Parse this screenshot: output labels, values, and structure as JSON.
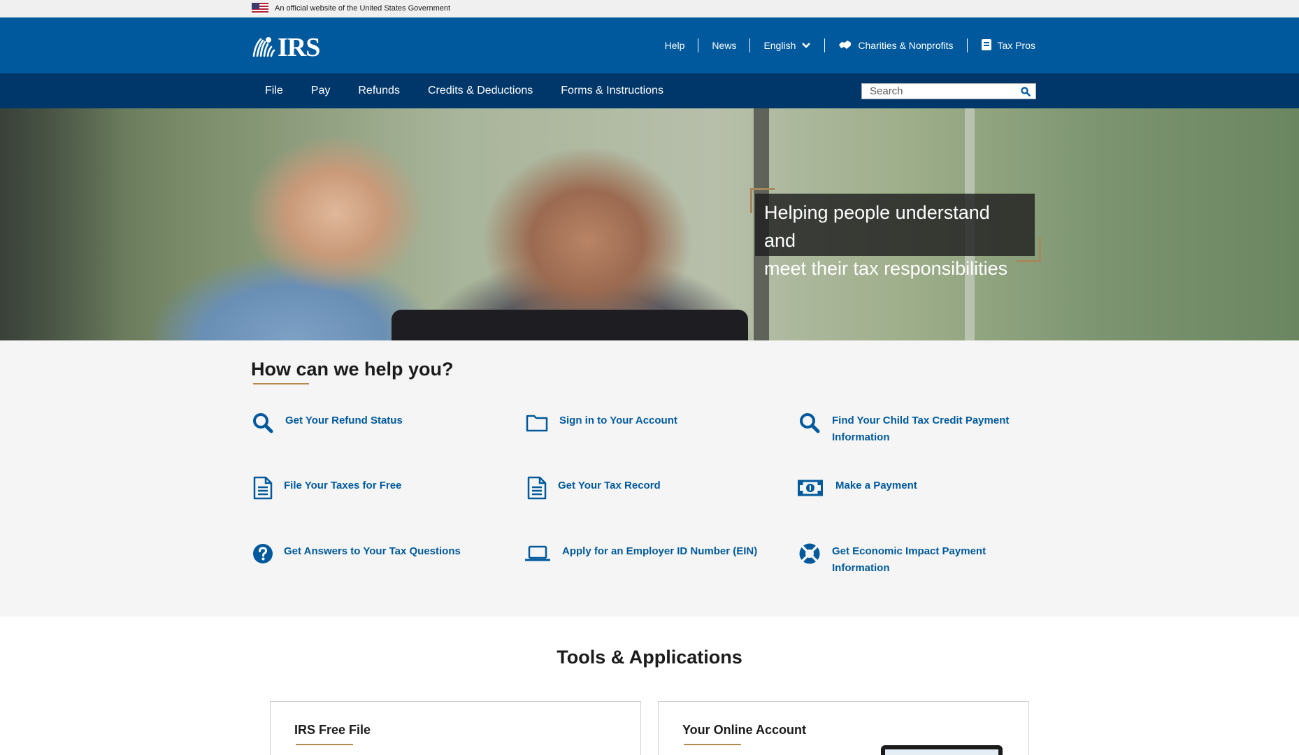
{
  "gov_banner": {
    "text": "An official website of the United States Government",
    "flag_icon": "us-flag-icon"
  },
  "header": {
    "logo_text": "IRS",
    "logo_icon": "eagle-icon",
    "utility": {
      "help": "Help",
      "news": "News",
      "language": "English",
      "charities": "Charities & Nonprofits",
      "tax_pros": "Tax Pros"
    }
  },
  "nav": {
    "items": [
      "File",
      "Pay",
      "Refunds",
      "Credits & Deductions",
      "Forms & Instructions"
    ],
    "search": {
      "placeholder": "Search"
    }
  },
  "hero": {
    "tagline_line1": "Helping people understand and",
    "tagline_line2": "meet their tax responsibilities"
  },
  "help": {
    "title": "How can we help you?",
    "items": [
      {
        "label": "Get Your Refund Status",
        "icon": "search-icon"
      },
      {
        "label": "Sign in to Your Account",
        "icon": "folder-icon"
      },
      {
        "label": "Find Your Child Tax Credit Payment",
        "label2": "Information",
        "icon": "search-icon"
      },
      {
        "label": "File Your Taxes for Free",
        "icon": "document-icon"
      },
      {
        "label": "Get Your Tax Record",
        "icon": "document-icon"
      },
      {
        "label": "Make a Payment",
        "icon": "money-icon"
      },
      {
        "label": "Get Answers to Your Tax Questions",
        "icon": "question-icon"
      },
      {
        "label": "Apply for an Employer ID Number (EIN)",
        "icon": "laptop-icon"
      },
      {
        "label": "Get Economic Impact Payment",
        "label2": "Information",
        "icon": "lifebuoy-icon"
      }
    ]
  },
  "tools": {
    "title": "Tools & Applications",
    "cards": [
      {
        "title": "IRS Free File"
      },
      {
        "title": "Your Online Account"
      }
    ]
  },
  "colors": {
    "header_blue": "#00599c",
    "nav_navy": "#00376b",
    "link_blue": "#00599c",
    "accent_gold": "#b58a50"
  }
}
